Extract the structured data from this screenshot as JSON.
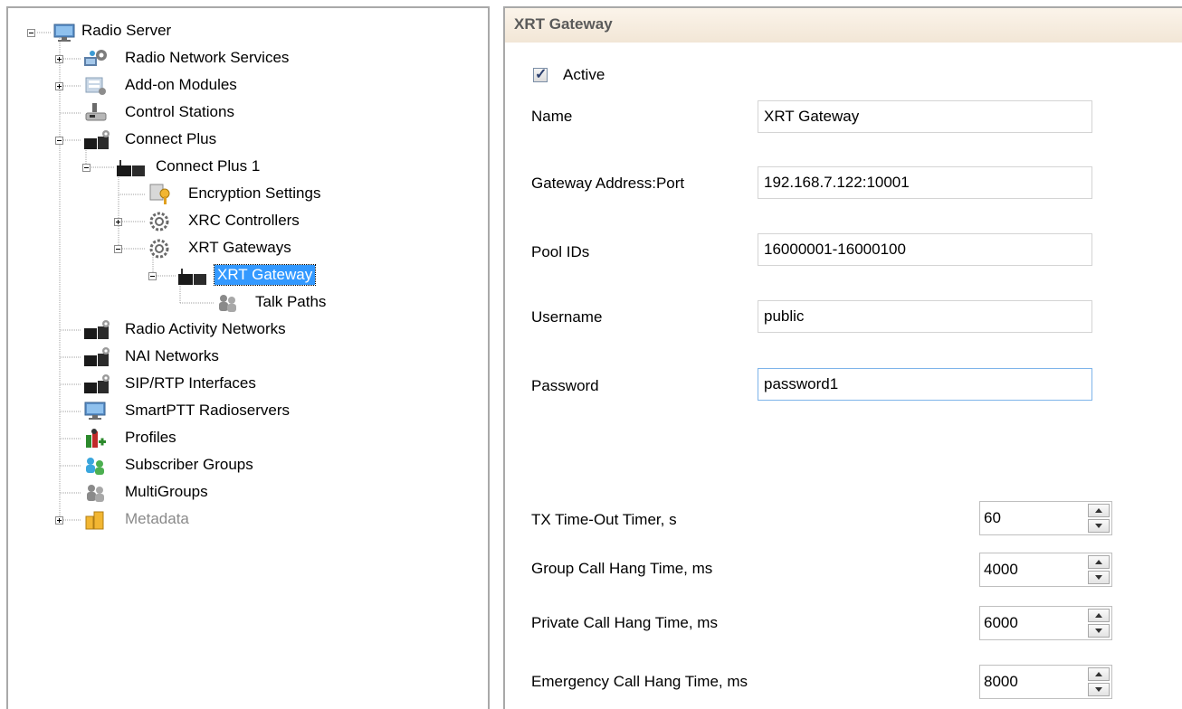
{
  "tree": {
    "root": "Radio Server",
    "radio_network_services": "Radio Network Services",
    "addon_modules": "Add-on Modules",
    "control_stations": "Control Stations",
    "connect_plus": "Connect Plus",
    "connect_plus_1": "Connect Plus 1",
    "encryption_settings": "Encryption Settings",
    "xrc_controllers": "XRC Controllers",
    "xrt_gateways": "XRT Gateways",
    "xrt_gateway": "XRT Gateway",
    "talk_paths": "Talk Paths",
    "radio_activity_networks": "Radio Activity Networks",
    "nai_networks": "NAI Networks",
    "sip_rtp_interfaces": "SIP/RTP Interfaces",
    "smartptt_radioservers": "SmartPTT Radioservers",
    "profiles": "Profiles",
    "subscriber_groups": "Subscriber Groups",
    "multigroups": "MultiGroups",
    "metadata": "Metadata"
  },
  "form": {
    "title": "XRT Gateway",
    "active_label": "Active",
    "active_checked": true,
    "name_label": "Name",
    "name_value": "XRT Gateway",
    "gateway_label": "Gateway Address:Port",
    "gateway_value": "192.168.7.122:10001",
    "pool_label": "Pool IDs",
    "pool_value": "16000001-16000100",
    "username_label": "Username",
    "username_value": "public",
    "password_label": "Password",
    "password_value": "password1",
    "tx_label": "TX Time-Out Timer, s",
    "tx_value": "60",
    "group_label": "Group Call Hang Time, ms",
    "group_value": "4000",
    "private_label": "Private Call Hang Time, ms",
    "private_value": "6000",
    "emergency_label": "Emergency Call Hang Time, ms",
    "emergency_value": "8000"
  },
  "colors": {
    "selection": "#3399ff",
    "header_bg": "#f5ebdd",
    "header_text": "#5a5a5a",
    "disabled_text": "#8a8a8a"
  }
}
